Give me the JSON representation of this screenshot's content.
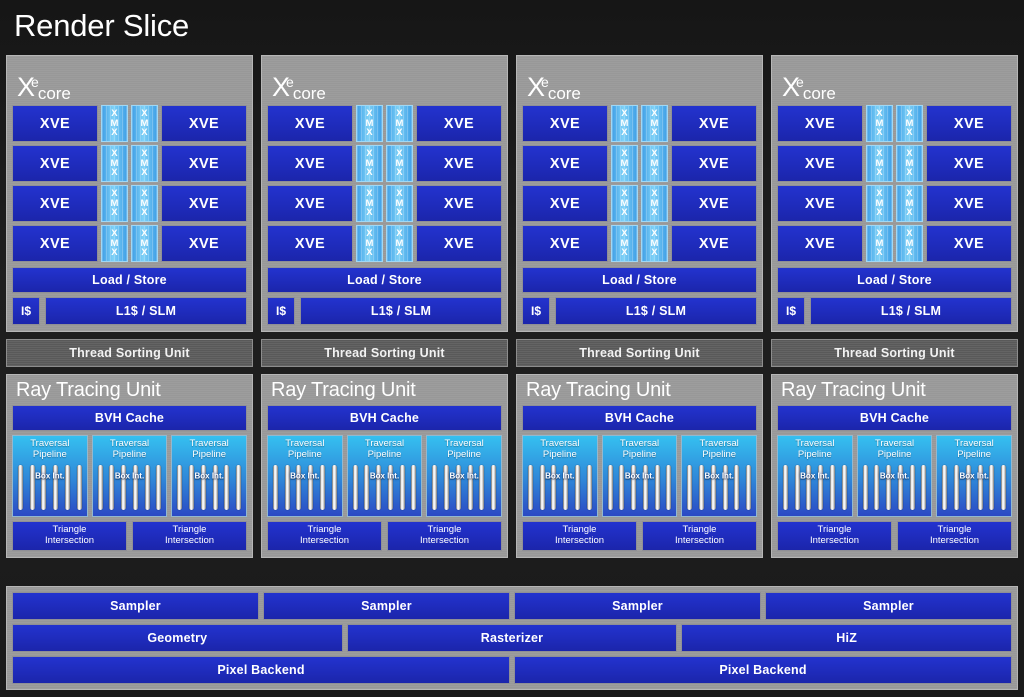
{
  "title": "Render Slice",
  "colors": {
    "background": "#1c1c1c",
    "panel_gray": "#9b9b9b",
    "block_blue": "#2333cf",
    "xmx_blue": "#7fd2f7",
    "traversal_cyan": "#35c0f0",
    "tsu_gray": "#5e5e5e",
    "text_white": "#ffffff"
  },
  "xe_core": {
    "logo_x": "X",
    "logo_superscript": "e",
    "logo_word": "core",
    "vector_engine_label": "XVE",
    "matrix_engine_label_chars": [
      "X",
      "M",
      "X"
    ],
    "rows": 4,
    "load_store_label": "Load / Store",
    "instruction_cache_label": "I$",
    "l1_slm_label": "L1$ / SLM"
  },
  "thread_sorting_unit": {
    "label": "Thread Sorting Unit"
  },
  "ray_tracing_unit": {
    "title": "Ray Tracing Unit",
    "bvh_cache_label": "BVH Cache",
    "traversal_pipeline_label_line1": "Traversal",
    "traversal_pipeline_label_line2": "Pipeline",
    "box_intersection_label": "Box Int.",
    "traversal_pipeline_count": 3,
    "box_int_bar_count": 6,
    "triangle_intersection_label_line1": "Triangle",
    "triangle_intersection_label_line2": "Intersection",
    "triangle_intersection_count": 2
  },
  "columns": [
    {
      "index": 1
    },
    {
      "index": 2
    },
    {
      "index": 3
    },
    {
      "index": 4
    }
  ],
  "bottom": {
    "samplers": [
      {
        "label": "Sampler"
      },
      {
        "label": "Sampler"
      },
      {
        "label": "Sampler"
      },
      {
        "label": "Sampler"
      }
    ],
    "fixed_function": [
      {
        "label": "Geometry",
        "flex": 334
      },
      {
        "label": "Rasterizer",
        "flex": 334
      },
      {
        "label": "HiZ",
        "flex": 334
      }
    ],
    "pixel_backend": [
      {
        "label": "Pixel Backend"
      },
      {
        "label": "Pixel Backend"
      }
    ]
  }
}
